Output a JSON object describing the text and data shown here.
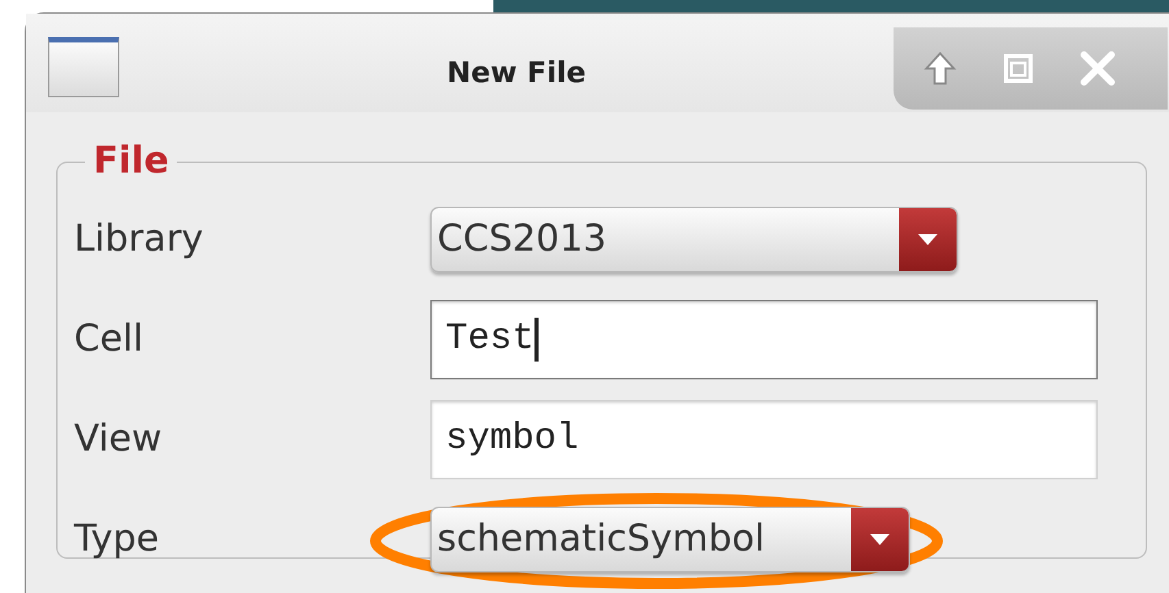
{
  "window": {
    "title": "New File"
  },
  "group": {
    "title": "File"
  },
  "rows": [
    {
      "label": "Library",
      "kind": "dropdown",
      "value": "CCS2013",
      "highlighted": false
    },
    {
      "label": "Cell",
      "kind": "text",
      "value": "Test",
      "focused": true,
      "highlighted": false
    },
    {
      "label": "View",
      "kind": "text",
      "value": "symbol",
      "focused": false,
      "highlighted": false
    },
    {
      "label": "Type",
      "kind": "dropdown",
      "value": "schematicSymbol",
      "highlighted": true
    }
  ]
}
